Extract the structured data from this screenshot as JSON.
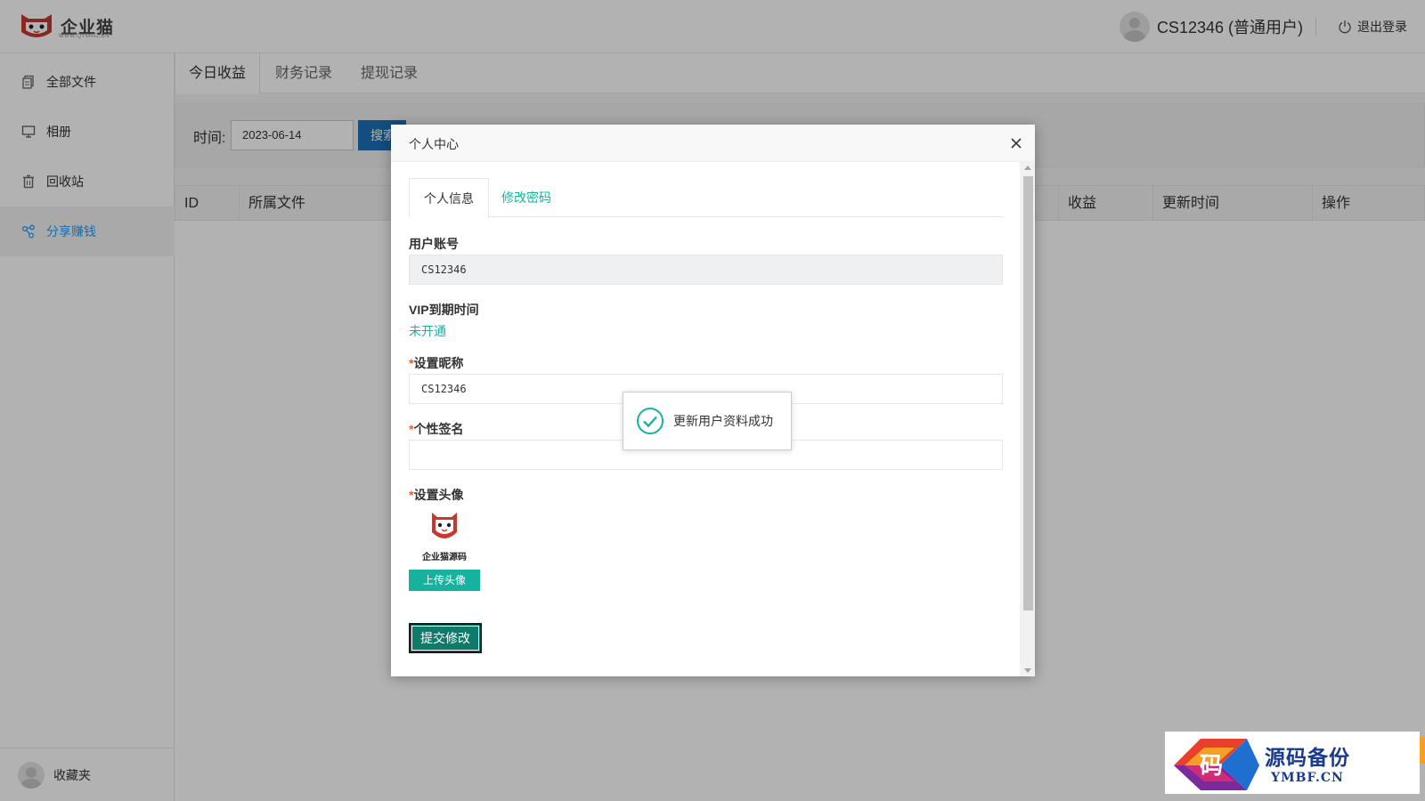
{
  "header": {
    "logo_text": "企业猫",
    "logo_sub": "WWW.QYMAO.CN",
    "user_name": "CS12346 (普通用户)",
    "logout_label": "退出登录"
  },
  "sidebar": {
    "items": [
      {
        "label": "全部文件",
        "icon": "files-icon"
      },
      {
        "label": "相册",
        "icon": "monitor-icon"
      },
      {
        "label": "回收站",
        "icon": "trash-icon"
      },
      {
        "label": "分享赚钱",
        "icon": "share-icon"
      }
    ],
    "active_index": 3,
    "bottom_label": "收藏夹"
  },
  "tabs": [
    "今日收益",
    "财务记录",
    "提现记录"
  ],
  "search": {
    "label": "时间:",
    "date_value": "2023-06-14",
    "button_label": "搜索"
  },
  "table": {
    "columns": [
      "ID",
      "所属文件",
      "收益",
      "更新时间",
      "操作"
    ]
  },
  "modal": {
    "title": "个人中心",
    "tabs": [
      "个人信息",
      "修改密码"
    ],
    "account_label": "用户账号",
    "account_value": "CS12346",
    "vip_label": "VIP到期时间",
    "vip_value": "未开通",
    "nickname_label": "设置昵称",
    "nickname_value": "CS12346",
    "signature_label": "个性签名",
    "signature_value": "",
    "avatar_label": "设置头像",
    "avatar_caption": "企业猫源码",
    "upload_label": "上传头像",
    "submit_label": "提交修改",
    "required_mark": "*"
  },
  "toast": {
    "message": "更新用户资料成功"
  },
  "watermark": {
    "glyph": "码",
    "cn": "源码备份",
    "en": "YMBF.CN"
  },
  "colors": {
    "accent": "#16b29e",
    "primary_blue": "#1e9fff",
    "search_button": "#1e6fb8",
    "brand_red": "#c8382e"
  }
}
